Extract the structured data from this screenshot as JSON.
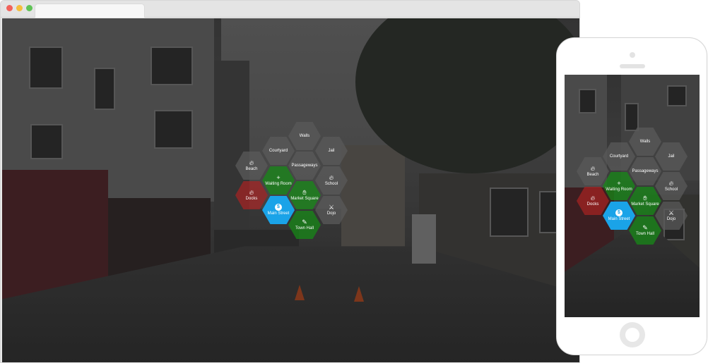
{
  "browser": {
    "window_controls": [
      "close",
      "minimize",
      "maximize"
    ]
  },
  "colors": {
    "main_street": "#1aa3e8",
    "green_tile": "#168c16",
    "red_tile": "#aa2222",
    "gray_tile": "#5a5a5a"
  },
  "hex_menu": {
    "walls": "Walls",
    "courtyard": "Courtyard",
    "jail": "Jail",
    "passageways": "Passageways",
    "beach": "Beach",
    "waiting_room": "Waiting Room",
    "school": "School",
    "docks": "Docks",
    "market_square": "Market Square",
    "main_street": "Main Street",
    "dojo": "Dojo",
    "town_hall": "Town Hall"
  },
  "icons": {
    "beach": "fire-icon",
    "waiting_room": "plus-icon",
    "school": "fire-icon",
    "docks": "fire-icon",
    "market_square": "hand-icon",
    "main_street": "coin-icon",
    "main_street_glyph": "$",
    "dojo": "martial-arts-icon",
    "town_hall": "edit-icon"
  }
}
